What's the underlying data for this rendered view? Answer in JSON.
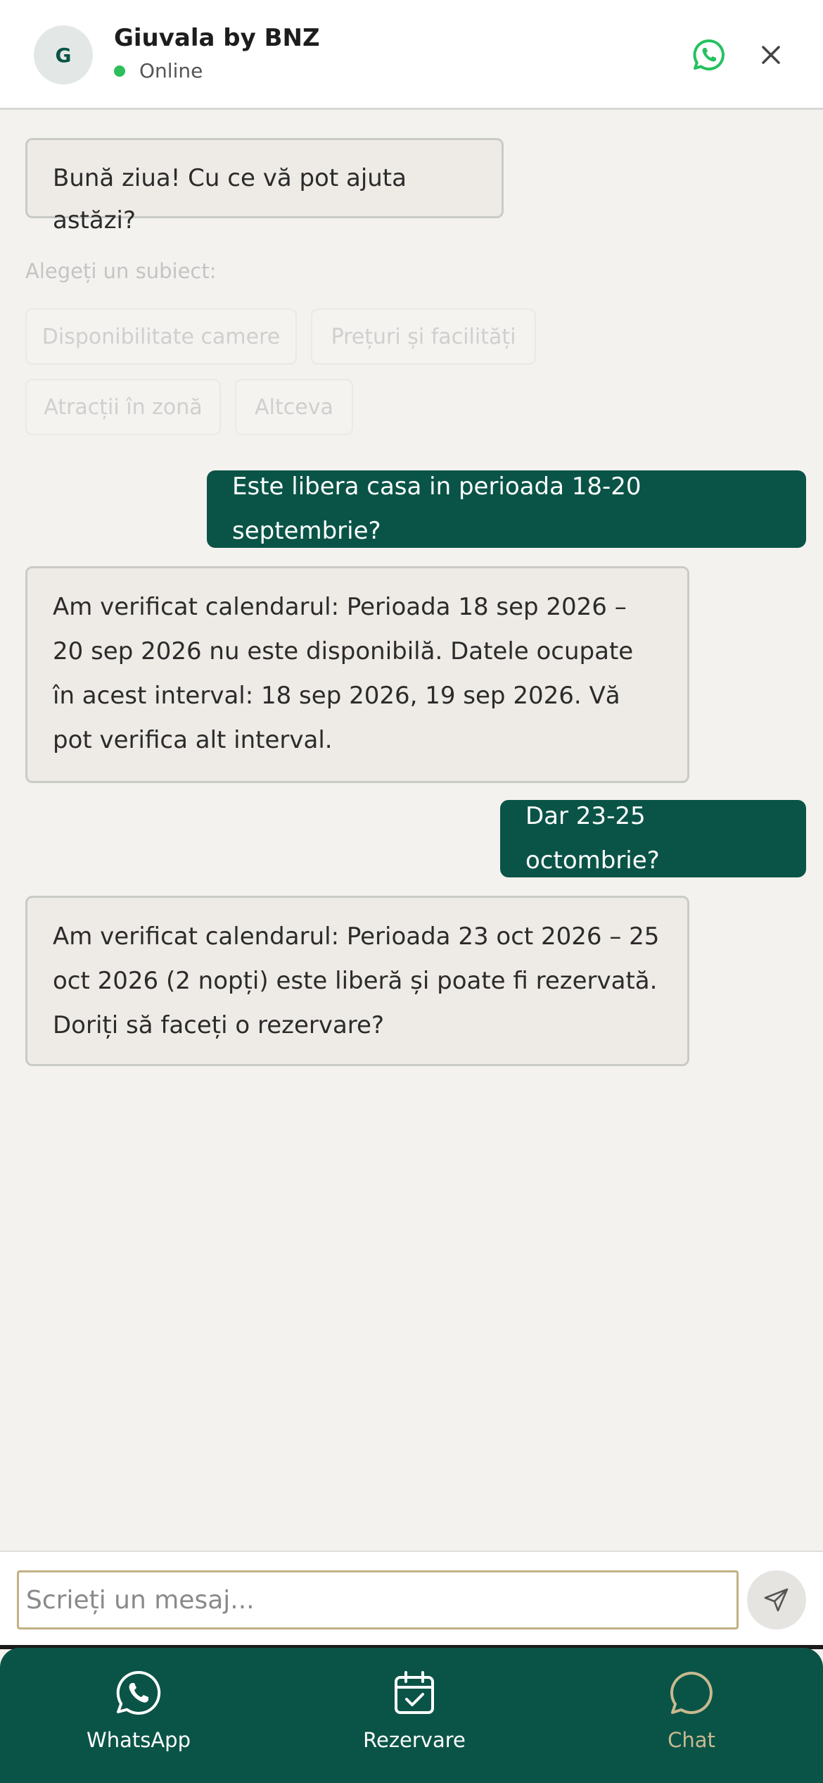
{
  "header": {
    "avatar_letter": "G",
    "title": "Giuvala by BNZ",
    "status": "Online"
  },
  "messages": [
    {
      "from": "bot",
      "text": "Bună ziua! Cu ce vă pot ajuta astăzi?"
    },
    {
      "from": "user",
      "text": "Este libera casa in perioada 18-20 septembrie?"
    },
    {
      "from": "bot",
      "text": "Am verificat calendarul: Perioada 18 sep 2026 – 20 sep 2026 nu este disponibilă. Datele ocupate în acest interval: 18 sep 2026, 19 sep 2026. Vă pot verifica alt interval."
    },
    {
      "from": "user",
      "text": "Dar 23-25 octombrie?"
    },
    {
      "from": "bot",
      "text": "Am verificat calendarul: Perioada 23 oct 2026 – 25 oct 2026 (2 nopți) este liberă și poate fi rezervată. Doriți să faceți o rezervare?"
    }
  ],
  "subjects": {
    "label": "Alegeți un subiect:",
    "chips": [
      "Disponibilitate camere",
      "Prețuri și facilități",
      "Atracții în zonă",
      "Altceva"
    ]
  },
  "composer": {
    "placeholder": "Scrieți un mesaj..."
  },
  "nav": {
    "items": [
      {
        "label": "WhatsApp",
        "icon": "whatsapp-icon",
        "active": false
      },
      {
        "label": "Rezervare",
        "icon": "calendar-check-icon",
        "active": false
      },
      {
        "label": "Chat",
        "icon": "chat-bubble-icon",
        "active": true
      }
    ]
  },
  "colors": {
    "brand": "#0a5447",
    "accent": "#c9b98f",
    "online": "#2dbd5a",
    "whatsapp": "#25c15f"
  }
}
